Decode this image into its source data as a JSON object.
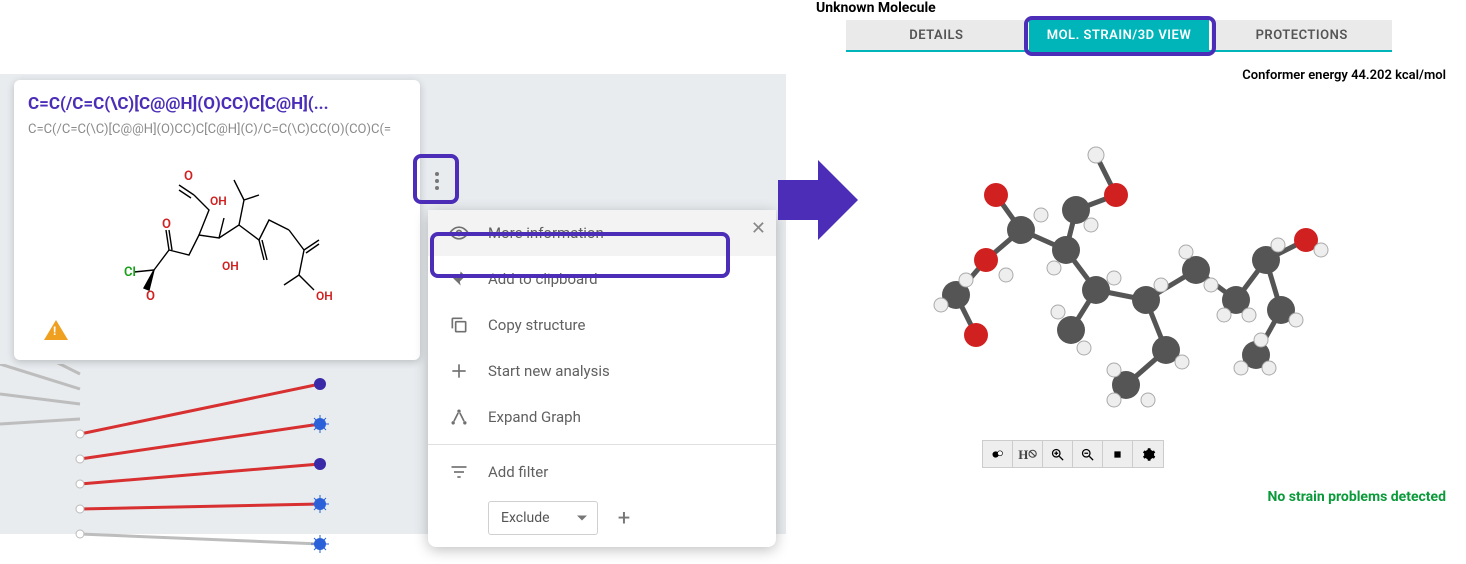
{
  "left": {
    "card": {
      "title_smiles": "C=C(/C=C(\\C)[C@@H](O)CC)C[C@H](...",
      "subtitle_smiles": "C=C(/C=C(\\C)[C@@H](O)CC)C[C@H](C)/C=C(\\C)CC(O)(CO)C(=",
      "structure_labels": {
        "cl": "Cl",
        "o": "O",
        "oh": "OH"
      }
    },
    "menu": {
      "items": [
        {
          "icon": "eye-icon",
          "label": "More information"
        },
        {
          "icon": "pin-icon",
          "label": "Add to clipboard"
        },
        {
          "icon": "copy-icon",
          "label": "Copy structure"
        },
        {
          "icon": "plus-icon",
          "label": "Start new analysis"
        },
        {
          "icon": "graph-icon",
          "label": "Expand Graph"
        },
        {
          "icon": "filter-icon",
          "label": "Add filter"
        }
      ],
      "filter_select": "Exclude"
    }
  },
  "right": {
    "page_title": "Unknown Molecule",
    "tabs": [
      {
        "label": "DETAILS",
        "active": false
      },
      {
        "label": "MOL. STRAIN/3D VIEW",
        "active": true
      },
      {
        "label": "PROTECTIONS",
        "active": false
      }
    ],
    "conformer_energy_label": "Conformer energy 44.202 kcal/mol",
    "strain_status": "No strain problems detected",
    "toolbar": [
      "color-atoms-icon",
      "toggle-hydrogen-icon",
      "zoom-in-icon",
      "zoom-out-icon",
      "stop-icon",
      "settings-icon"
    ]
  }
}
